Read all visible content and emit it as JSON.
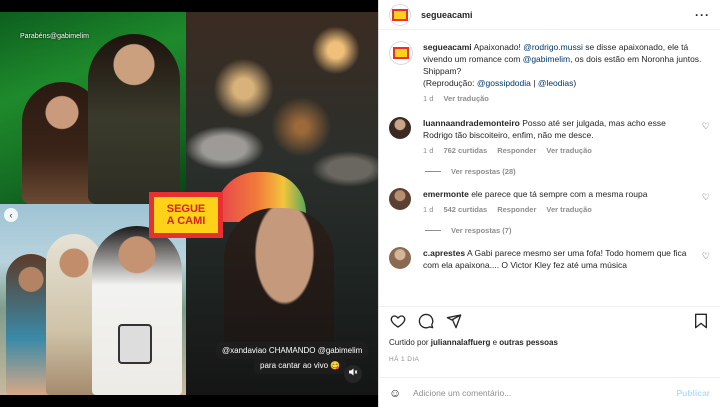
{
  "media": {
    "top_left_caption_line1": "Parabéns",
    "top_left_caption_line2": "@gabimelim",
    "logo_line1": "SEGUE",
    "logo_line2": "A CAMI",
    "video_caption_line1": "@xandaviao CHAMANDO @gabimelim",
    "video_caption_line2": "para cantar ao vivo 😋",
    "nav_prev_icon": "chevron-left-icon",
    "sound_icon": "speaker-icon"
  },
  "header": {
    "username": "segueacami",
    "more_label": "···"
  },
  "caption": {
    "username": "segueacami",
    "text_part1": " Apaixonado! ",
    "mention1": "@rodrigo.mussi",
    "text_part2": " se disse apaixonado, ele tá vivendo um romance com ",
    "mention2": "@gabimelim",
    "text_part3": ", os dois estão em Noronha juntos. Shippam?",
    "text_part4": "(Reprodução: ",
    "mention3": "@gossipdodia",
    "sep": " | ",
    "mention4": "@leodias",
    "text_part5": ")",
    "age": "1 d",
    "translate": "Ver tradução"
  },
  "comments": [
    {
      "username": "luannaandrademonteiro",
      "text": " Posso até ser julgada, mas acho esse Rodrigo tão biscoiteiro, enfim, não me desce.",
      "age": "1 d",
      "likes": "762 curtidas",
      "reply": "Responder",
      "translate": "Ver tradução",
      "replies": "Ver respostas (28)"
    },
    {
      "username": "emermonte",
      "text": " ele parece que tá sempre com a mesma roupa",
      "age": "1 d",
      "likes": "542 curtidas",
      "reply": "Responder",
      "translate": "Ver tradução",
      "replies": "Ver respostas (7)"
    },
    {
      "username": "c.aprestes",
      "text": " A Gabi parece mesmo ser uma fofa! Todo homem que fica com ela apaixona.... O Victor Kley fez até uma música"
    }
  ],
  "footer": {
    "liked_prefix": "Curtido por ",
    "liked_user": "juliannalaffuerg",
    "liked_suffix": " e ",
    "liked_others": "outras pessoas",
    "time": "HÁ 1 DIA",
    "comment_placeholder": "Adicione um comentário...",
    "publish": "Publicar"
  },
  "colors": {
    "link": "#00376b",
    "muted": "#8e8e8e",
    "publish_disabled": "#b2dffc",
    "logo_red": "#e83030",
    "logo_yellow": "#ffd21a"
  }
}
